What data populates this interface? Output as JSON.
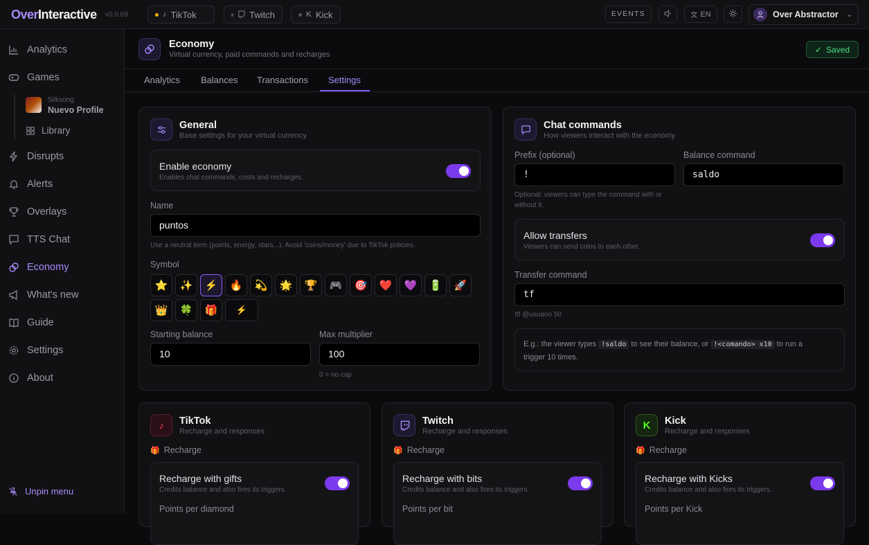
{
  "app": {
    "name_a": "Over",
    "name_b": "Interactive",
    "version": "v0.0.69"
  },
  "topbar": {
    "platforms": [
      {
        "label": "TikTok",
        "dot": "#eab308"
      },
      {
        "label": "Twitch",
        "dot": "#52525b"
      },
      {
        "label": "Kick",
        "dot": "#52525b"
      }
    ],
    "events": "EVENTS",
    "lang": "EN",
    "user": "Over Abstractor"
  },
  "sidebar": {
    "items": [
      {
        "label": "Analytics"
      },
      {
        "label": "Games"
      },
      {
        "label": "Disrupts"
      },
      {
        "label": "Alerts"
      },
      {
        "label": "Overlays"
      },
      {
        "label": "TTS Chat"
      },
      {
        "label": "Economy"
      },
      {
        "label": "What's new"
      },
      {
        "label": "Guide"
      },
      {
        "label": "Settings"
      },
      {
        "label": "About"
      }
    ],
    "game": {
      "small": "Silksong",
      "name": "Nuevo Profile"
    },
    "library": "Library",
    "unpin": "Unpin menu"
  },
  "header": {
    "title": "Economy",
    "subtitle": "Virtual currency, paid commands and recharges",
    "saved": "Saved"
  },
  "tabs": [
    "Analytics",
    "Balances",
    "Transactions",
    "Settings"
  ],
  "general": {
    "title": "General",
    "subtitle": "Base settings for your virtual currency",
    "enable_title": "Enable economy",
    "enable_sub": "Enables chat commands, costs and recharges.",
    "name_label": "Name",
    "name_value": "puntos",
    "name_hint": "Use a neutral term (points, energy, stars...). Avoid 'coins/money' due to TikTok policies.",
    "symbol_label": "Symbol",
    "symbols": [
      "⭐",
      "✨",
      "⚡",
      "🔥",
      "💫",
      "🌟",
      "🏆",
      "🎮",
      "🎯",
      "❤️",
      "💜",
      "🔋",
      "🚀",
      "👑",
      "🍀",
      "🎁",
      "⚡"
    ],
    "start_label": "Starting balance",
    "start_value": "10",
    "max_label": "Max multiplier",
    "max_value": "100",
    "max_hint": "0 = no cap"
  },
  "chat": {
    "title": "Chat commands",
    "subtitle": "How viewers interact with the economy",
    "prefix_label": "Prefix (optional)",
    "prefix_value": "!",
    "balance_label": "Balance command",
    "balance_value": "saldo",
    "prefix_hint": "Optional: viewers can type the command with or without it.",
    "transfer_title": "Allow transfers",
    "transfer_sub": "Viewers can send coins to each other.",
    "transfer_cmd_label": "Transfer command",
    "transfer_cmd_value": "tf",
    "transfer_hint": "!tf @usuario 50",
    "info_a": "E.g.: the viewer types",
    "info_code1": "!saldo",
    "info_b": "to see their balance, or",
    "info_code2": "!<comando> x10",
    "info_c": "to run a",
    "info_d": "trigger 10 times."
  },
  "platform_cards": [
    {
      "title": "TikTok",
      "subtitle": "Recharge and responses",
      "section": "Recharge",
      "box_title": "Recharge with gifts",
      "box_sub": "Credits balance and also fires its triggers.",
      "field": "Points per diamond"
    },
    {
      "title": "Twitch",
      "subtitle": "Recharge and responses",
      "section": "Recharge",
      "box_title": "Recharge with bits",
      "box_sub": "Credits balance and also fires its triggers.",
      "field": "Points per bit"
    },
    {
      "title": "Kick",
      "subtitle": "Recharge and responses",
      "section": "Recharge",
      "box_title": "Recharge with Kicks",
      "box_sub": "Credits balance and also fires its triggers.",
      "field": "Points per Kick"
    }
  ]
}
